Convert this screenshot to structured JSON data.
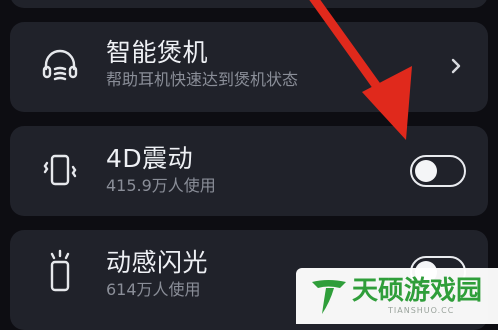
{
  "settings": {
    "items": [
      {
        "title": "智能煲机",
        "subtitle": "帮助耳机快速达到煲机状态",
        "icon": "headset-burn-in-icon",
        "control": "chevron-right-icon"
      },
      {
        "title": "4D震动",
        "subtitle": "415.9万人使用",
        "icon": "phone-vibration-icon",
        "control": "toggle",
        "enabled": false
      },
      {
        "title": "动感闪光",
        "subtitle": "614万人使用",
        "icon": "phone-flash-icon",
        "control": "toggle",
        "enabled": false
      }
    ]
  },
  "colors": {
    "background": "#0d0d12",
    "card": "#20222a",
    "annotation_arrow": "#e0291c",
    "watermark_green": "#2f9e3a"
  },
  "watermark": {
    "text": "天硕游戏园",
    "subtext": "TIANSHUO.CC"
  }
}
